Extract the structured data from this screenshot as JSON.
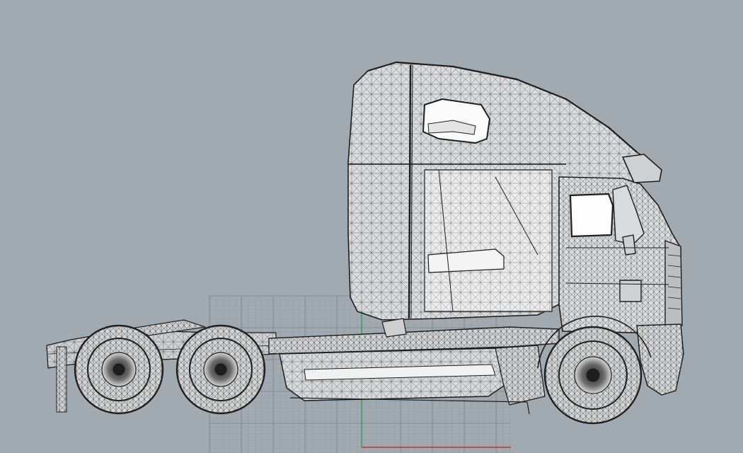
{
  "viewport": {
    "view_name": "Right",
    "display_mode": "ghosted-wireframe",
    "background_color": "#a1a9b1",
    "grid_color": "#8e969e",
    "grid_major_color": "#7c848c",
    "axis_x_color": "#c0392b",
    "axis_y_color": "#27ae60"
  },
  "model": {
    "object": "semi-truck-tractor",
    "mesh_color": "#1e1e1e",
    "surface_color": "#e2e3e4",
    "glass_color": "#ffffff"
  }
}
